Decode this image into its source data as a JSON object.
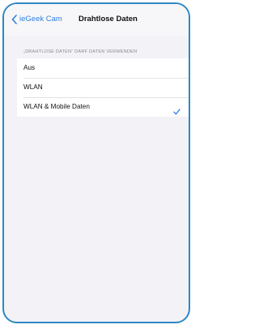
{
  "navbar": {
    "back_label": "ieGeek Cam",
    "title": "Drahtlose Daten"
  },
  "section": {
    "header": "„DRAHTLOSE DATEN“ DARF DATEN VERWENDEN"
  },
  "options": [
    {
      "label": "Aus",
      "selected": false
    },
    {
      "label": "WLAN",
      "selected": false
    },
    {
      "label": "WLAN & Mobile Daten",
      "selected": true
    }
  ],
  "colors": {
    "accent": "#2f7fe0",
    "frame": "#2f88c4",
    "background": "#f2f2f7"
  },
  "icons": {
    "back": "chevron-left-icon",
    "selected": "checkmark-icon"
  }
}
